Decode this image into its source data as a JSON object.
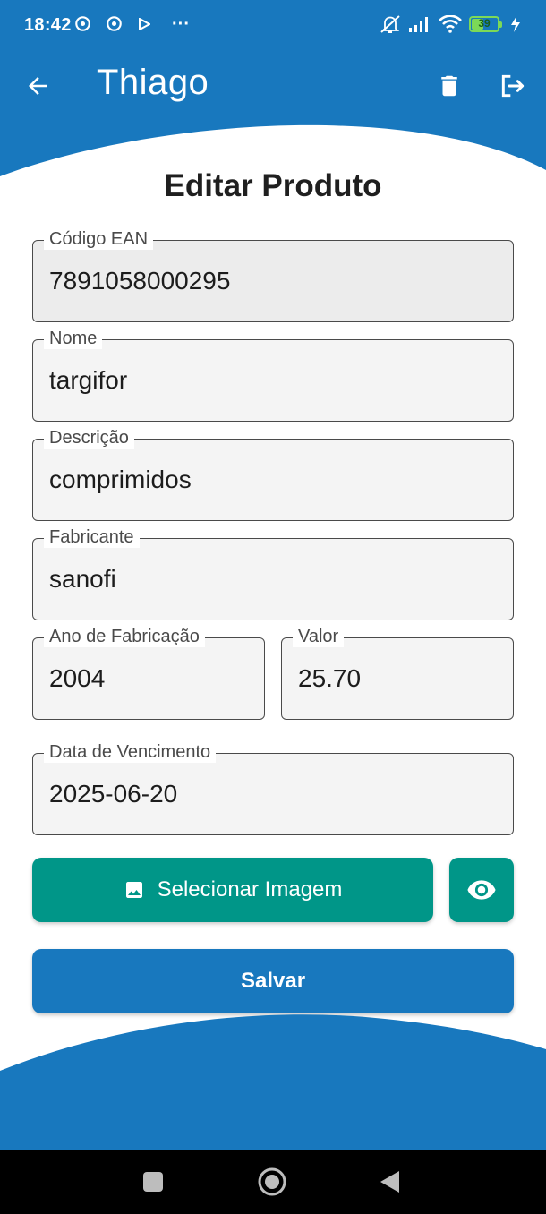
{
  "status_bar": {
    "time": "18:42",
    "more_indicator": "···",
    "battery_level": "39",
    "icons": [
      "chrome-icon",
      "chrome-icon",
      "play-icon",
      "bell-off-icon",
      "signal-icon",
      "wifi-icon",
      "battery-icon",
      "charging-bolt-icon"
    ]
  },
  "app_bar": {
    "title": "Thiago",
    "back_icon": "arrow-left-icon",
    "delete_icon": "trash-icon",
    "logout_icon": "logout-icon"
  },
  "form": {
    "title": "Editar Produto",
    "fields": {
      "ean": {
        "label": "Código EAN",
        "value": "7891058000295"
      },
      "nome": {
        "label": "Nome",
        "value": "targifor"
      },
      "descricao": {
        "label": "Descrição",
        "value": "comprimidos"
      },
      "fabricante": {
        "label": "Fabricante",
        "value": "sanofi"
      },
      "ano": {
        "label": "Ano de Fabricação",
        "value": "2004"
      },
      "valor": {
        "label": "Valor",
        "value": "25.70"
      },
      "vencimento": {
        "label": "Data de Vencimento",
        "value": "2025-06-20"
      }
    },
    "select_image_label": "Selecionar Imagem",
    "save_label": "Salvar"
  },
  "colors": {
    "primary": "#1878be",
    "secondary": "#009688",
    "field_bg": "#f4f4f4",
    "field_border": "#4a4a4a",
    "battery": "#7cd957"
  }
}
